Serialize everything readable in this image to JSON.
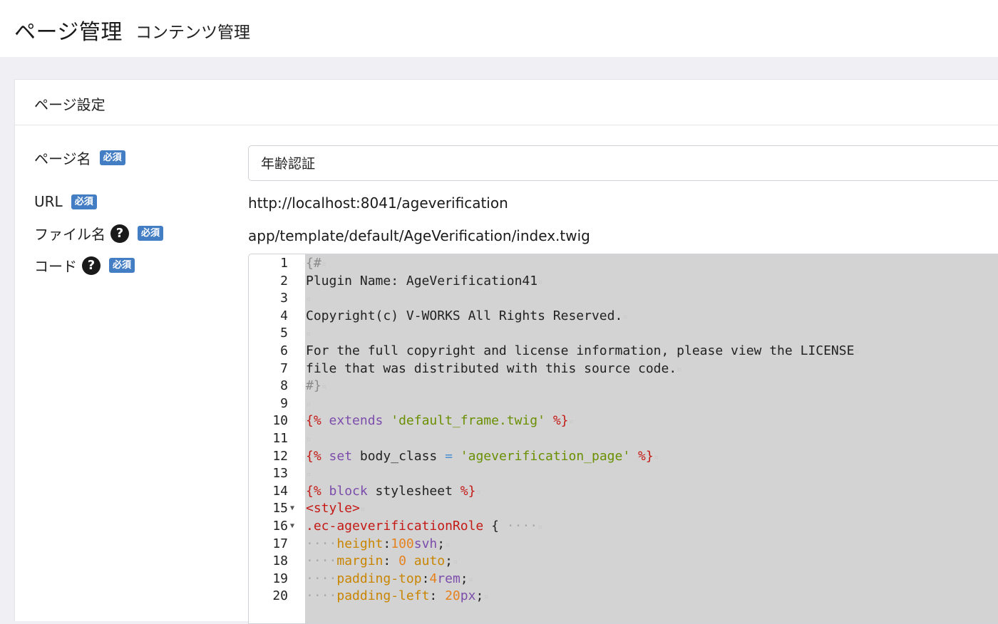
{
  "header": {
    "title": "ページ管理",
    "subtitle": "コンテンツ管理"
  },
  "card": {
    "title": "ページ設定"
  },
  "form": {
    "required_badge": "必須",
    "page_name": {
      "label": "ページ名",
      "value": "年齢認証"
    },
    "url": {
      "label": "URL",
      "value": "http://localhost:8041/ageverification"
    },
    "file_name": {
      "label": "ファイル名",
      "value": "app/template/default/AgeVerification/index.twig"
    },
    "code": {
      "label": "コード"
    }
  },
  "editor": {
    "lines": [
      {
        "n": "1",
        "tokens": [
          [
            "comment",
            "{#"
          ]
        ]
      },
      {
        "n": "2",
        "tokens": [
          [
            "plain",
            "Plugin Name: AgeVerification41"
          ]
        ]
      },
      {
        "n": "3",
        "tokens": []
      },
      {
        "n": "4",
        "tokens": [
          [
            "plain",
            "Copyright(c) V-WORKS All Rights Reserved."
          ]
        ]
      },
      {
        "n": "5",
        "tokens": []
      },
      {
        "n": "6",
        "tokens": [
          [
            "plain",
            "For the full copyright and license information, please view the LICENSE"
          ]
        ]
      },
      {
        "n": "7",
        "tokens": [
          [
            "plain",
            "file that was distributed with this source code."
          ]
        ]
      },
      {
        "n": "8",
        "tokens": [
          [
            "comment",
            "#}"
          ]
        ]
      },
      {
        "n": "9",
        "tokens": []
      },
      {
        "n": "10",
        "tokens": [
          [
            "tag",
            "{%"
          ],
          [
            "plain",
            " "
          ],
          [
            "kw",
            "extends"
          ],
          [
            "plain",
            " "
          ],
          [
            "str",
            "'default_frame.twig'"
          ],
          [
            "plain",
            " "
          ],
          [
            "tag",
            "%}"
          ]
        ]
      },
      {
        "n": "11",
        "tokens": []
      },
      {
        "n": "12",
        "tokens": [
          [
            "tag",
            "{%"
          ],
          [
            "plain",
            " "
          ],
          [
            "kw",
            "set"
          ],
          [
            "plain",
            " body_class "
          ],
          [
            "op",
            "="
          ],
          [
            "plain",
            " "
          ],
          [
            "str",
            "'ageverification_page'"
          ],
          [
            "plain",
            " "
          ],
          [
            "tag",
            "%}"
          ]
        ]
      },
      {
        "n": "13",
        "tokens": []
      },
      {
        "n": "14",
        "tokens": [
          [
            "tag",
            "{%"
          ],
          [
            "plain",
            " "
          ],
          [
            "kw",
            "block"
          ],
          [
            "plain",
            " stylesheet "
          ],
          [
            "tag",
            "%}"
          ]
        ]
      },
      {
        "n": "15",
        "fold": true,
        "tokens": [
          [
            "tag",
            "<style>"
          ]
        ]
      },
      {
        "n": "16",
        "fold": true,
        "tokens": [
          [
            "tag",
            ".ec-ageverificationRole"
          ],
          [
            "plain",
            " {"
          ],
          [
            "ws",
            " ····"
          ]
        ]
      },
      {
        "n": "17",
        "tokens": [
          [
            "ws",
            "····"
          ],
          [
            "prop",
            "height"
          ],
          [
            "plain",
            ":"
          ],
          [
            "num",
            "100"
          ],
          [
            "unit",
            "svh"
          ],
          [
            "plain",
            ";"
          ]
        ]
      },
      {
        "n": "18",
        "tokens": [
          [
            "ws",
            "····"
          ],
          [
            "prop",
            "margin"
          ],
          [
            "plain",
            ": "
          ],
          [
            "num",
            "0"
          ],
          [
            "plain",
            " "
          ],
          [
            "prop",
            "auto"
          ],
          [
            "plain",
            ";"
          ]
        ]
      },
      {
        "n": "19",
        "tokens": [
          [
            "ws",
            "····"
          ],
          [
            "prop",
            "padding-top"
          ],
          [
            "plain",
            ":"
          ],
          [
            "num",
            "4"
          ],
          [
            "unit",
            "rem"
          ],
          [
            "plain",
            ";"
          ]
        ]
      },
      {
        "n": "20",
        "tokens": [
          [
            "ws",
            "····"
          ],
          [
            "prop",
            "padding-left"
          ],
          [
            "plain",
            ": "
          ],
          [
            "num",
            "20"
          ],
          [
            "unit",
            "px"
          ],
          [
            "plain",
            ";"
          ]
        ]
      }
    ]
  }
}
